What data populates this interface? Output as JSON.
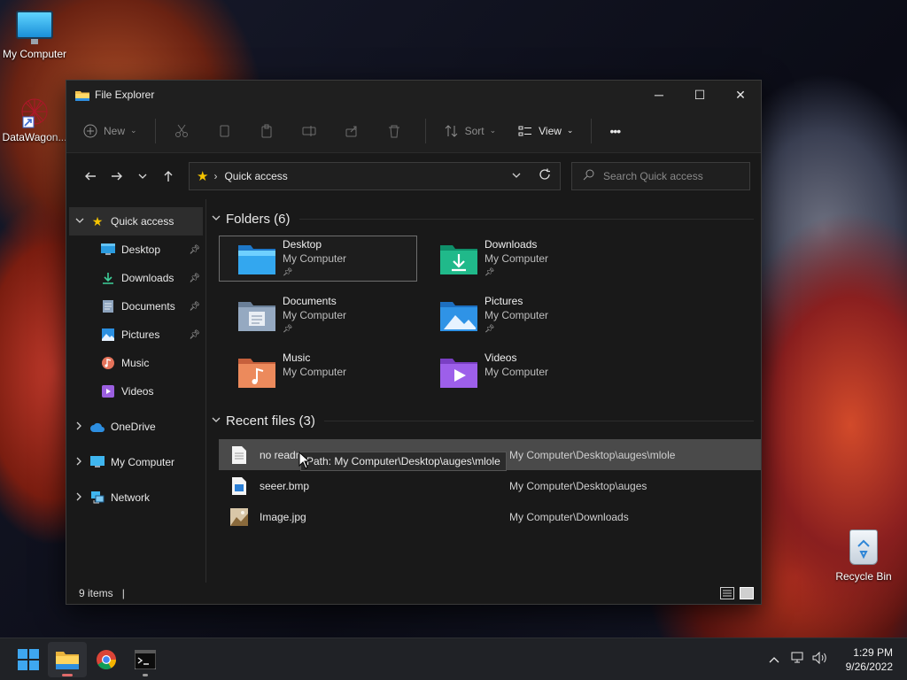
{
  "desktop": {
    "icons": [
      {
        "label": "My Computer"
      },
      {
        "label": "DataWagon..."
      },
      {
        "label": "Recycle Bin"
      }
    ]
  },
  "window": {
    "title": "File Explorer",
    "controls": {
      "minimize": "─",
      "maximize": "☐",
      "close": "✕"
    }
  },
  "toolbar": {
    "new_label": "New",
    "sort_label": "Sort",
    "view_label": "View",
    "more_label": "•••"
  },
  "navbar": {
    "address": "Quick access",
    "search_placeholder": "Search Quick access"
  },
  "sidebar": {
    "quick_access": "Quick access",
    "items": [
      {
        "label": "Desktop",
        "pinned": true
      },
      {
        "label": "Downloads",
        "pinned": true
      },
      {
        "label": "Documents",
        "pinned": true
      },
      {
        "label": "Pictures",
        "pinned": true
      },
      {
        "label": "Music",
        "pinned": false
      },
      {
        "label": "Videos",
        "pinned": false
      }
    ],
    "onedrive": "OneDrive",
    "my_computer": "My Computer",
    "network": "Network"
  },
  "folders": {
    "header": "Folders (6)",
    "items": [
      {
        "name": "Desktop",
        "location": "My Computer",
        "pinned": true
      },
      {
        "name": "Downloads",
        "location": "My Computer",
        "pinned": true
      },
      {
        "name": "Documents",
        "location": "My Computer",
        "pinned": true
      },
      {
        "name": "Pictures",
        "location": "My Computer",
        "pinned": true
      },
      {
        "name": "Music",
        "location": "My Computer",
        "pinned": false
      },
      {
        "name": "Videos",
        "location": "My Computer",
        "pinned": false
      }
    ]
  },
  "recent": {
    "header": "Recent files (3)",
    "files": [
      {
        "name": "no readme.txt",
        "path": "My Computer\\Desktop\\auges\\mlole"
      },
      {
        "name": "seeer.bmp",
        "path": "My Computer\\Desktop\\auges"
      },
      {
        "name": "Image.jpg",
        "path": "My Computer\\Downloads"
      }
    ],
    "tooltip": "Path: My Computer\\Desktop\\auges\\mlole"
  },
  "status": {
    "items": "9 items",
    "caret": "|"
  },
  "taskbar": {
    "time": "1:29 PM",
    "date": "9/26/2022"
  },
  "colors": {
    "accent": "#f5c400",
    "window_bg": "#191919",
    "taskbar_bg": "#202226"
  }
}
